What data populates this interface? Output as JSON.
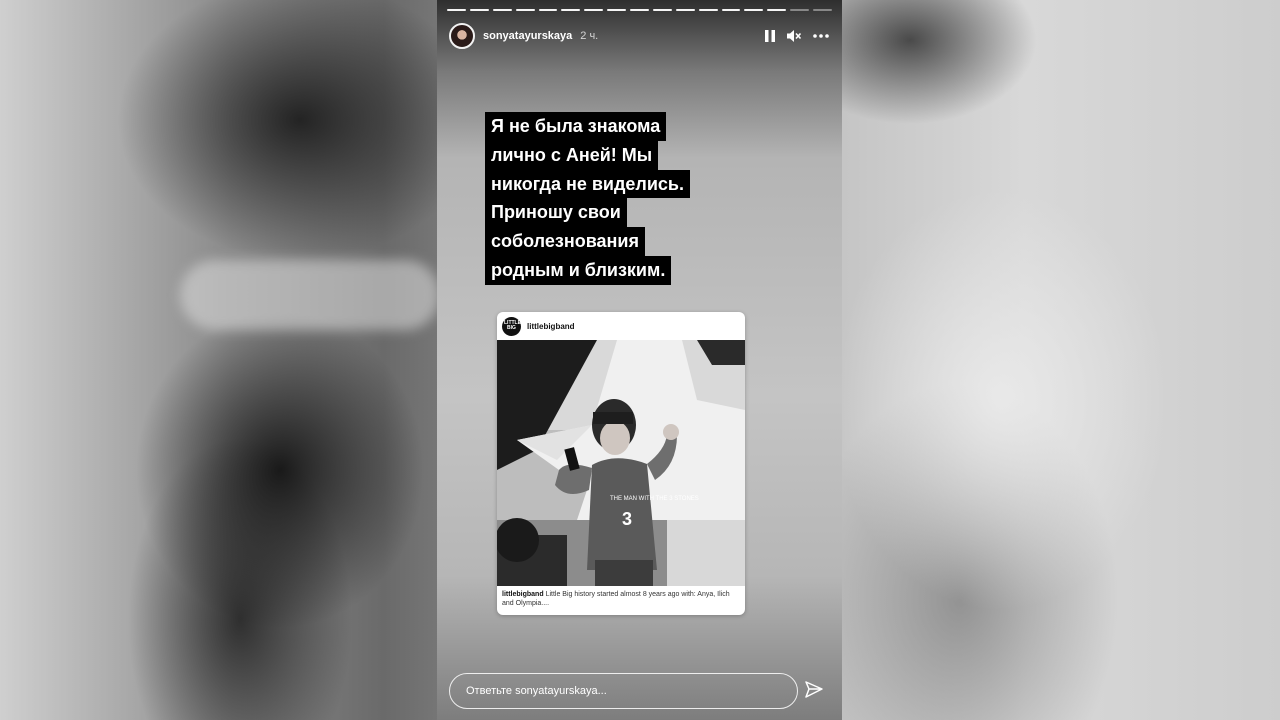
{
  "story": {
    "username": "sonyatayurskaya",
    "time_ago": "2 ч.",
    "segments_total": 17,
    "segments_viewed": 15
  },
  "caption_lines": [
    "Я не была знакома",
    "лично с Аней! Мы",
    "никогда не виделись.",
    "Приношу свои",
    "соболезнования",
    "родным и близким."
  ],
  "post": {
    "avatar_text": "LITTLE BIG",
    "username": "littlebigband",
    "caption_user": "littlebigband",
    "caption_text": "Little Big history started almost 8 years ago with: Anya, Ilich and Olympia....",
    "shirt_text": "THE MAN WITH THE 3 STONES"
  },
  "reply": {
    "placeholder": "Ответьте sonyatayurskaya..."
  },
  "icons": {
    "pause": "pause-icon",
    "mute": "speaker-muted-icon",
    "more": "more-dots-icon",
    "send": "paper-plane-icon"
  },
  "colors": {
    "caption_bg": "#000000",
    "caption_fg": "#ffffff",
    "text_light": "#ffffff"
  }
}
